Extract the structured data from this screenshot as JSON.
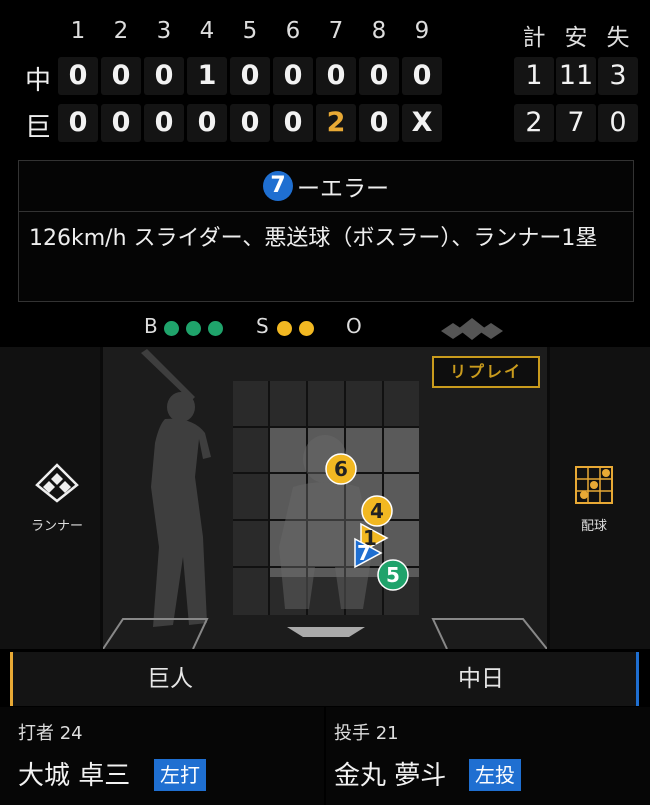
{
  "scoreboard": {
    "innings": [
      "1",
      "2",
      "3",
      "4",
      "5",
      "6",
      "7",
      "8",
      "9"
    ],
    "totals_headers": [
      "計",
      "安",
      "失"
    ],
    "teams": [
      {
        "abbr": "中",
        "runs": [
          "0",
          "0",
          "0",
          "1",
          "0",
          "0",
          "0",
          "0",
          "0"
        ],
        "totals": [
          "1",
          "11",
          "3"
        ]
      },
      {
        "abbr": "巨",
        "runs": [
          "0",
          "0",
          "0",
          "0",
          "0",
          "0",
          "2",
          "0",
          "X"
        ],
        "totals": [
          "2",
          "7",
          "0"
        ]
      }
    ]
  },
  "play": {
    "fielder_number": "7",
    "title": "ーエラー",
    "description": "126km/h スライダー、悪送球（ボスラー）、ランナー1塁"
  },
  "count": {
    "balls_label": "B",
    "balls": 3,
    "strikes_label": "S",
    "strikes": 2,
    "outs_label": "O",
    "outs": 0
  },
  "field": {
    "replay_label": "リプレイ",
    "runner_label": "ランナー",
    "pitch_label": "配球",
    "pitches": [
      {
        "num": "6",
        "type": "circle",
        "color": "#f2b822"
      },
      {
        "num": "4",
        "type": "circle",
        "color": "#f2b822"
      },
      {
        "num": "1",
        "type": "triangle",
        "color": "#f2b822"
      },
      {
        "num": "7",
        "type": "triangle",
        "color": "#1f6fd1"
      },
      {
        "num": "5",
        "type": "circle",
        "color": "#1fa36b"
      }
    ]
  },
  "teams_bar": {
    "home": "巨人",
    "away": "中日"
  },
  "batter": {
    "role": "打者",
    "number": "24",
    "name": "大城 卓三",
    "hand": "左打"
  },
  "pitcher": {
    "role": "投手",
    "number": "21",
    "name": "金丸 夢斗",
    "hand": "左投"
  },
  "colors": {
    "accent_orange": "#e8a935",
    "accent_blue": "#1f6fd1",
    "ball_green": "#1fa36b",
    "strike_yellow": "#f2b822"
  }
}
